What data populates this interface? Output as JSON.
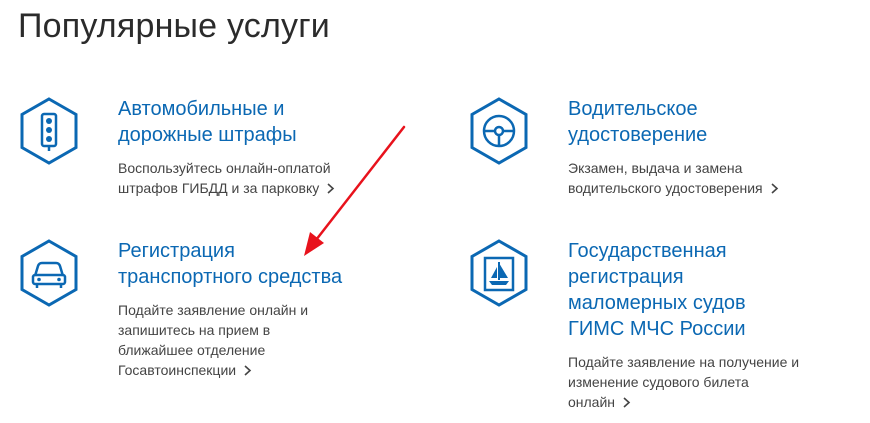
{
  "page": {
    "title": "Популярные услуги"
  },
  "services": [
    {
      "title_line1": "Автомобильные и",
      "title_line2": "дорожные штрафы",
      "desc_line1": "Воспользуйтесь онлайн-оплатой",
      "desc_line2": "штрафов ГИБДД и за парковку",
      "icon": "traffic-light-icon"
    },
    {
      "title_line1": "Водительское",
      "title_line2": "удостоверение",
      "desc_line1": "Экзамен, выдача и замена",
      "desc_line2": "водительского удостоверения",
      "icon": "steering-wheel-icon"
    },
    {
      "title_line1": "Регистрация",
      "title_line2": "транспортного средства",
      "desc_line1": "Подайте заявление онлайн и",
      "desc_line2": "запишитесь на прием в",
      "desc_line3": "ближайшее отделение",
      "desc_line4": "Госавтоинспекции",
      "icon": "car-icon"
    },
    {
      "title_line1": "Государственная",
      "title_line2": "регистрация",
      "title_line3": "маломерных судов",
      "title_line4": "ГИМС МЧС России",
      "desc_line1": "Подайте заявление на получение и",
      "desc_line2": "изменение судового билета",
      "desc_line3": "онлайн",
      "icon": "sailboat-icon"
    }
  ],
  "colors": {
    "accent": "#0b68b3",
    "annotation_arrow": "#e8121c"
  }
}
